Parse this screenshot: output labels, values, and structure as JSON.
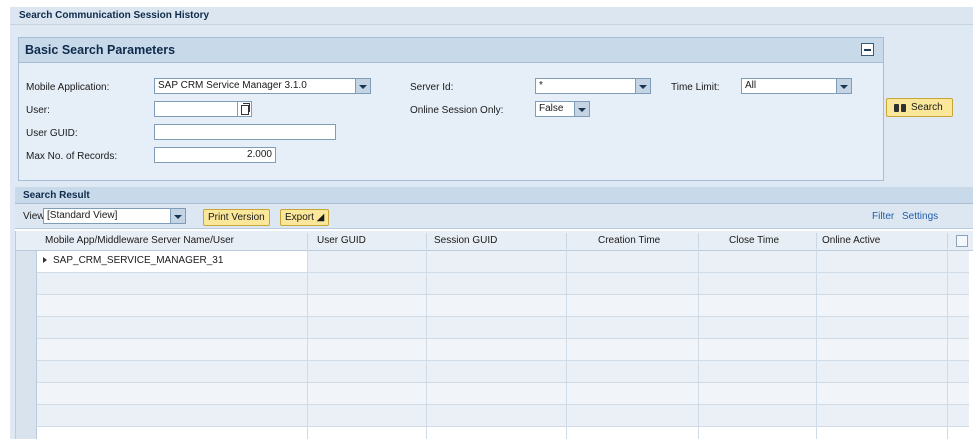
{
  "page": {
    "title": "Search Communication Session History"
  },
  "search_params": {
    "title": "Basic Search Parameters",
    "mobile_application": {
      "label": "Mobile Application:",
      "value": "SAP CRM Service Manager 3.1.0"
    },
    "user": {
      "label": "User:",
      "value": ""
    },
    "user_guid": {
      "label": "User GUID:",
      "value": ""
    },
    "max_records": {
      "label": "Max No. of Records:",
      "value": "2.000"
    },
    "server_id": {
      "label": "Server Id:",
      "value": "*"
    },
    "online_session_only": {
      "label": "Online Session Only:",
      "value": "False"
    },
    "time_limit": {
      "label": "Time Limit:",
      "value": "All"
    },
    "search_button": "Search"
  },
  "search_result": {
    "title": "Search Result",
    "view_label": "View",
    "view_value": "[Standard View]",
    "print_version": "Print Version",
    "export": "Export ◢",
    "filter": "Filter",
    "settings": "Settings",
    "columns": [
      "Mobile App/Middleware Server Name/User",
      "User GUID",
      "Session GUID",
      "Creation Time",
      "Close Time",
      "Online Active"
    ],
    "rows": [
      {
        "name": "SAP_CRM_SERVICE_MANAGER_31",
        "user_guid": "",
        "session_guid": "",
        "creation_time": "",
        "close_time": "",
        "online_active": ""
      }
    ]
  },
  "colors": {
    "header_bg": "#c8d9ea",
    "panel_bg": "#e6eef7",
    "button_bg": "#fbe79a",
    "link": "#1f5ea8"
  }
}
